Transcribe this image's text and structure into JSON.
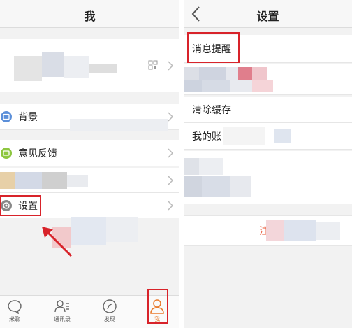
{
  "left": {
    "title": "我",
    "menu": {
      "background": "背景",
      "feedback": "意见反馈",
      "settings": "设置"
    },
    "tabs": [
      {
        "label": "米聊",
        "icon": "chat-bubble-icon"
      },
      {
        "label": "通讯录",
        "icon": "contacts-icon"
      },
      {
        "label": "发现",
        "icon": "compass-icon"
      },
      {
        "label": "我",
        "icon": "person-icon"
      }
    ],
    "active_tab_color": "#e97b2d"
  },
  "right": {
    "title": "设置",
    "items": {
      "message_reminder": "消息提醒",
      "clear_cache": "清除缓存",
      "my_account": "我的账",
      "logout": "注"
    }
  },
  "colors": {
    "highlight": "#d8232a",
    "background_icon": "#5b8fd9",
    "feedback_icon": "#8dc63f",
    "settings_icon": "#888888"
  }
}
